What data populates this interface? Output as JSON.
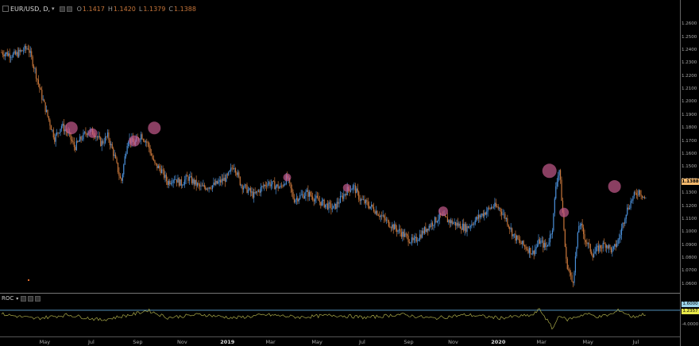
{
  "header": {
    "symbol": "EUR/USD, D,",
    "caret": "▾",
    "ohlc": [
      {
        "label": "O",
        "value": "1.1417"
      },
      {
        "label": "H",
        "value": "1.1420"
      },
      {
        "label": "L",
        "value": "1.1379"
      },
      {
        "label": "C",
        "value": "1.1388"
      }
    ]
  },
  "price_axis": {
    "ticks": [
      "1.2600",
      "1.2500",
      "1.2400",
      "1.2300",
      "1.2200",
      "1.2100",
      "1.2000",
      "1.1900",
      "1.1800",
      "1.1700",
      "1.1600",
      "1.1500",
      "1.1400",
      "1.1300",
      "1.1200",
      "1.1100",
      "1.1000",
      "1.0900",
      "1.0800",
      "1.0700",
      "1.0600"
    ],
    "tick_values": [
      1.26,
      1.25,
      1.24,
      1.23,
      1.22,
      1.21,
      1.2,
      1.19,
      1.18,
      1.17,
      1.16,
      1.15,
      1.14,
      1.13,
      1.12,
      1.11,
      1.1,
      1.09,
      1.08,
      1.07,
      1.06
    ],
    "last_price": "1.1388",
    "last_value": 1.1388
  },
  "roc": {
    "label": "ROC",
    "caret": "▾",
    "tag1": "1.6000",
    "tag2": "1.2357",
    "axis_low": "-4.0000"
  },
  "time_axis": [
    {
      "label": "May",
      "bold": false,
      "t": 0.065
    },
    {
      "label": "Jul",
      "bold": false,
      "t": 0.135
    },
    {
      "label": "Sep",
      "bold": false,
      "t": 0.205
    },
    {
      "label": "Nov",
      "bold": false,
      "t": 0.272
    },
    {
      "label": "2019",
      "bold": true,
      "t": 0.34
    },
    {
      "label": "Mar",
      "bold": false,
      "t": 0.405
    },
    {
      "label": "May",
      "bold": false,
      "t": 0.475
    },
    {
      "label": "Jul",
      "bold": false,
      "t": 0.543
    },
    {
      "label": "Sep",
      "bold": false,
      "t": 0.613
    },
    {
      "label": "Nov",
      "bold": false,
      "t": 0.68
    },
    {
      "label": "2020",
      "bold": true,
      "t": 0.748
    },
    {
      "label": "Mar",
      "bold": false,
      "t": 0.813
    },
    {
      "label": "May",
      "bold": false,
      "t": 0.883
    },
    {
      "label": "Jul",
      "bold": false,
      "t": 0.955
    }
  ],
  "chart_data": {
    "type": "line",
    "title": "EUR/USD, D,",
    "ylim": [
      1.055,
      1.265
    ],
    "x": [
      0,
      0.02,
      0.04,
      0.05,
      0.06,
      0.07,
      0.08,
      0.09,
      0.1,
      0.11,
      0.12,
      0.13,
      0.14,
      0.15,
      0.16,
      0.17,
      0.18,
      0.19,
      0.2,
      0.21,
      0.22,
      0.23,
      0.24,
      0.25,
      0.26,
      0.27,
      0.28,
      0.3,
      0.32,
      0.34,
      0.35,
      0.36,
      0.38,
      0.4,
      0.42,
      0.43,
      0.44,
      0.46,
      0.48,
      0.5,
      0.52,
      0.53,
      0.54,
      0.56,
      0.58,
      0.6,
      0.62,
      0.64,
      0.66,
      0.68,
      0.7,
      0.72,
      0.74,
      0.75,
      0.76,
      0.77,
      0.78,
      0.79,
      0.8,
      0.81,
      0.82,
      0.825,
      0.83,
      0.835,
      0.84,
      0.845,
      0.85,
      0.86,
      0.87,
      0.88,
      0.89,
      0.9,
      0.91,
      0.92,
      0.93,
      0.94,
      0.95,
      0.96,
      0.97
    ],
    "values": [
      1.238,
      1.236,
      1.242,
      1.225,
      1.205,
      1.188,
      1.172,
      1.182,
      1.176,
      1.165,
      1.172,
      1.178,
      1.176,
      1.168,
      1.174,
      1.158,
      1.138,
      1.172,
      1.168,
      1.175,
      1.168,
      1.152,
      1.148,
      1.138,
      1.142,
      1.137,
      1.142,
      1.134,
      1.136,
      1.142,
      1.152,
      1.137,
      1.128,
      1.138,
      1.134,
      1.142,
      1.125,
      1.13,
      1.123,
      1.118,
      1.132,
      1.135,
      1.125,
      1.118,
      1.108,
      1.1,
      1.092,
      1.103,
      1.112,
      1.107,
      1.103,
      1.112,
      1.12,
      1.118,
      1.11,
      1.098,
      1.092,
      1.088,
      1.084,
      1.093,
      1.088,
      1.095,
      1.105,
      1.138,
      1.148,
      1.115,
      1.078,
      1.06,
      1.108,
      1.093,
      1.083,
      1.088,
      1.091,
      1.085,
      1.095,
      1.115,
      1.126,
      1.132,
      1.125,
      1.128,
      1.135
    ]
  },
  "roc_data": {
    "type": "line",
    "ylim": [
      -5,
      5
    ],
    "x": [
      0,
      0.05,
      0.1,
      0.15,
      0.2,
      0.22,
      0.25,
      0.3,
      0.35,
      0.4,
      0.45,
      0.5,
      0.55,
      0.6,
      0.65,
      0.7,
      0.75,
      0.8,
      0.81,
      0.82,
      0.83,
      0.84,
      0.85,
      0.88,
      0.9,
      0.92,
      0.93,
      0.95,
      0.97
    ],
    "values": [
      0.5,
      -0.8,
      0.3,
      -1.2,
      0.5,
      1.6,
      -0.5,
      0.4,
      -0.6,
      0.3,
      -0.4,
      0.2,
      -0.5,
      0.4,
      -0.7,
      0.3,
      -0.6,
      0.2,
      1.9,
      -0.8,
      -3.8,
      0.4,
      -1.2,
      0.6,
      -0.3,
      0.5,
      1.7,
      -0.4,
      0.6
    ]
  },
  "markers": [
    {
      "t": 0.105,
      "price": 1.18,
      "r": 8
    },
    {
      "t": 0.137,
      "price": 1.176,
      "r": 6
    },
    {
      "t": 0.2,
      "price": 1.17,
      "r": 7
    },
    {
      "t": 0.23,
      "price": 1.18,
      "r": 8
    },
    {
      "t": 0.43,
      "price": 1.142,
      "r": 5
    },
    {
      "t": 0.52,
      "price": 1.134,
      "r": 5
    },
    {
      "t": 0.665,
      "price": 1.116,
      "r": 6
    },
    {
      "t": 0.825,
      "price": 1.147,
      "r": 9
    },
    {
      "t": 0.847,
      "price": 1.115,
      "r": 6
    },
    {
      "t": 0.923,
      "price": 1.135,
      "r": 8
    }
  ],
  "colors": {
    "up": "#4a8fd8",
    "down": "#c8763a",
    "marker": "#c45a8c",
    "roc": "#a8a848",
    "roc_zero": "#5fa8d8"
  }
}
